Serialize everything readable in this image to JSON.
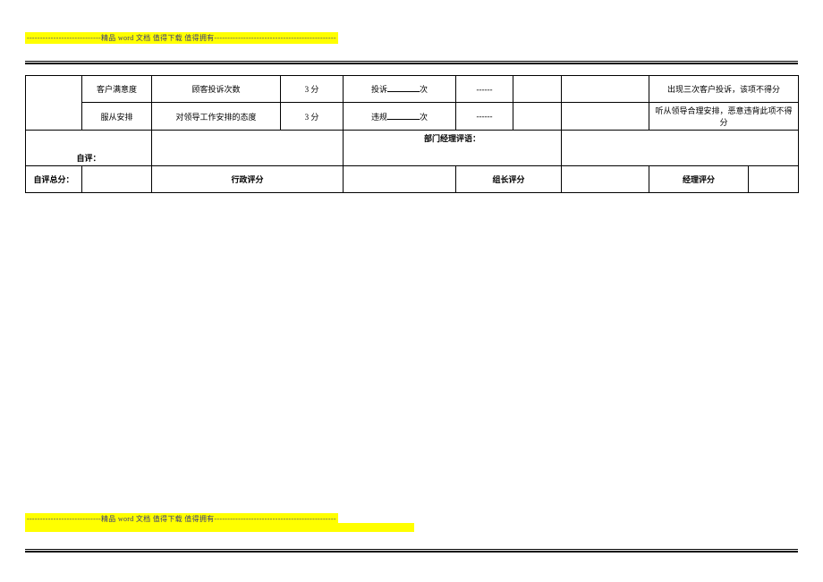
{
  "banner": {
    "text": "----------------------------精品 word 文档  值得下载  值得拥有----------------------------------------------"
  },
  "rows": {
    "r1": {
      "c2": "客户满意度",
      "c3": "顾客投诉次数",
      "c4": "3 分",
      "c5_prefix": "投诉",
      "c5_suffix": "次",
      "c6": "------",
      "c9": "出现三次客户投诉，该项不得分"
    },
    "r2": {
      "c2": "服从安排",
      "c3": "对领导工作安排的态度",
      "c4": "3 分",
      "c5_prefix": "违规",
      "c5_suffix": "次",
      "c6": "------",
      "c9": "听从领导合理安排，恶意违背此项不得分"
    },
    "r3": {
      "label_self": "自评：",
      "label_mgr": "部门经理评语："
    },
    "r4": {
      "c1": "自评总分：",
      "c3": "行政评分",
      "c5": "组长评分",
      "c7": "经理评分"
    }
  }
}
